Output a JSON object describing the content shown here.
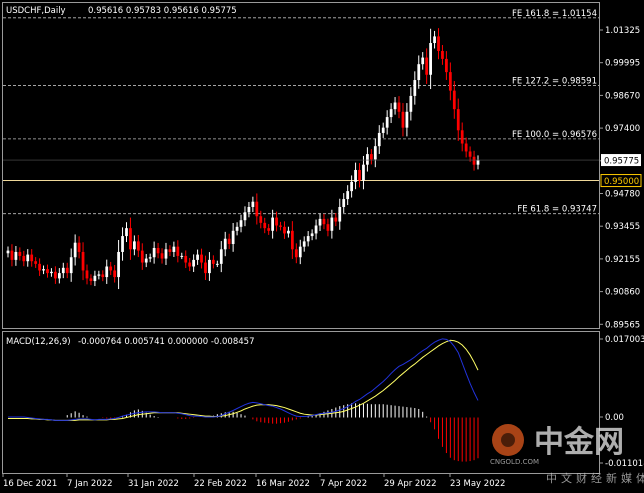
{
  "header": {
    "symbol": "USDCHF,Daily",
    "ohlc": "0.95616 0.95783 0.95616 0.95775"
  },
  "macd_header": {
    "label": "MACD(12,26,9)",
    "values": "-0.000764 0.005741 0.000000 -0.008457"
  },
  "watermark": {
    "cn_big": "中金网",
    "url": "CNGOLD.COM",
    "cn_small": "中文财经新媒体"
  },
  "colors": {
    "background": "#000000",
    "bull": "#ffffff",
    "bear": "#ff0000",
    "macd_main": "#2233dd",
    "macd_signal": "#ffff66",
    "hist_pos": "#ffffff",
    "hist_neg": "#ff0000",
    "level_line": "#f0d99a",
    "current_price_label": "#ffffff",
    "level_label": "#ffcc00"
  },
  "chart_data": [
    {
      "type": "candlestick",
      "title": "USDCHF,Daily",
      "x_tick_labels": [
        "16 Dec 2021",
        "7 Jan 2022",
        "31 Jan 2022",
        "22 Feb 2022",
        "16 Mar 2022",
        "7 Apr 2022",
        "29 Apr 2022",
        "23 May 2022"
      ],
      "y_tick_labels": [
        "1.01325",
        "0.99995",
        "0.98670",
        "0.97400",
        "0.96075",
        "0.94780",
        "0.93455",
        "0.92155",
        "0.90860",
        "0.89565"
      ],
      "ylim": [
        0.895,
        1.016
      ],
      "current_price": 0.95775,
      "current_price_label": "0.95775",
      "level": 0.95,
      "level_label": "0.95000",
      "fibonacci_levels": [
        {
          "label": "FE 161.8 = 1.01154",
          "value": 1.01154
        },
        {
          "label": "FE 127.2 = 0.98591",
          "value": 0.98591
        },
        {
          "label": "FE 100.0 = 0.96576",
          "value": 0.96576
        },
        {
          "label": "FE 61.8 = 0.93747",
          "value": 0.93747
        }
      ],
      "close": [
        0.9235,
        0.92,
        0.923,
        0.9215,
        0.9195,
        0.922,
        0.9195,
        0.9185,
        0.916,
        0.9165,
        0.915,
        0.9155,
        0.913,
        0.915,
        0.917,
        0.915,
        0.921,
        0.9265,
        0.923,
        0.916,
        0.913,
        0.912,
        0.914,
        0.9145,
        0.9135,
        0.9175,
        0.916,
        0.9135,
        0.923,
        0.929,
        0.932,
        0.924,
        0.927,
        0.9235,
        0.919,
        0.9205,
        0.921,
        0.9245,
        0.9225,
        0.9205,
        0.924,
        0.923,
        0.925,
        0.9215,
        0.9215,
        0.919,
        0.9175,
        0.92,
        0.922,
        0.919,
        0.915,
        0.92,
        0.9185,
        0.9185,
        0.924,
        0.928,
        0.926,
        0.931,
        0.9325,
        0.935,
        0.938,
        0.94,
        0.942,
        0.9365,
        0.934,
        0.932,
        0.931,
        0.936,
        0.933,
        0.9325,
        0.93,
        0.931,
        0.924,
        0.921,
        0.925,
        0.927,
        0.929,
        0.93,
        0.933,
        0.9355,
        0.9335,
        0.931,
        0.936,
        0.9345,
        0.94,
        0.943,
        0.946,
        0.9495,
        0.954,
        0.95,
        0.956,
        0.96,
        0.958,
        0.963,
        0.968,
        0.97,
        0.974,
        0.977,
        0.9795,
        0.976,
        0.97,
        0.976,
        0.982,
        0.988,
        0.994,
        0.9965,
        0.99,
        1.002,
        1.0045,
        0.999,
        0.996,
        0.991,
        0.984,
        0.977,
        0.969,
        0.964,
        0.961,
        0.959,
        0.956,
        0.9577
      ]
    },
    {
      "type": "macd",
      "title": "MACD(12,26,9)",
      "y_tick_labels": [
        "0.017003",
        "0.00",
        "-0.011018"
      ],
      "ylim": [
        -0.0115,
        0.0172
      ],
      "macd": [
        0.0001,
        0.0001,
        0.0001,
        0.0001,
        0.0001,
        0.0,
        -0.0001,
        -0.0002,
        -0.0003,
        -0.0004,
        -0.0004,
        -0.0005,
        -0.0006,
        -0.0006,
        -0.0006,
        -0.0006,
        -0.0005,
        -0.0004,
        -0.0003,
        -0.0003,
        -0.0003,
        -0.0004,
        -0.0005,
        -0.0004,
        -0.0004,
        -0.0004,
        -0.0003,
        -0.0002,
        0.0,
        0.0003,
        0.0005,
        0.0007,
        0.0009,
        0.001,
        0.0011,
        0.0012,
        0.0012,
        0.0012,
        0.0011,
        0.001,
        0.001,
        0.001,
        0.001,
        0.0009,
        0.0008,
        0.0006,
        0.0004,
        0.0003,
        0.0003,
        0.0002,
        0.0001,
        0.0001,
        0.0001,
        0.0002,
        0.0004,
        0.0008,
        0.0011,
        0.0015,
        0.0019,
        0.0023,
        0.0027,
        0.003,
        0.0032,
        0.0031,
        0.0029,
        0.0027,
        0.0025,
        0.0024,
        0.0021,
        0.0018,
        0.0014,
        0.001,
        0.0006,
        0.0003,
        0.0002,
        0.0002,
        0.0003,
        0.0004,
        0.0006,
        0.0008,
        0.0009,
        0.001,
        0.0011,
        0.0013,
        0.0016,
        0.0019,
        0.0023,
        0.0028,
        0.0034,
        0.0038,
        0.0044,
        0.005,
        0.0055,
        0.0062,
        0.0069,
        0.0076,
        0.0084,
        0.0093,
        0.0101,
        0.0108,
        0.0112,
        0.0117,
        0.0122,
        0.0128,
        0.0135,
        0.0141,
        0.0146,
        0.0153,
        0.0159,
        0.0163,
        0.0166,
        0.0165,
        0.016,
        0.015,
        0.0137,
        0.0115,
        0.0093,
        0.0072,
        0.0053,
        0.0036
      ],
      "signal": [
        -0.0002,
        -0.0002,
        -0.0002,
        -0.0002,
        -0.0002,
        -0.0002,
        -0.0003,
        -0.0003,
        -0.0004,
        -0.0004,
        -0.0005,
        -0.0005,
        -0.0006,
        -0.0006,
        -0.0006,
        -0.0006,
        -0.0006,
        -0.0006,
        -0.0005,
        -0.0005,
        -0.0005,
        -0.0005,
        -0.0005,
        -0.0005,
        -0.0005,
        -0.0005,
        -0.0004,
        -0.0004,
        -0.0003,
        -0.0002,
        0.0,
        0.0002,
        0.0004,
        0.0006,
        0.0007,
        0.0008,
        0.0009,
        0.001,
        0.001,
        0.001,
        0.001,
        0.001,
        0.001,
        0.001,
        0.0009,
        0.0008,
        0.0007,
        0.0006,
        0.0005,
        0.0004,
        0.0003,
        0.0003,
        0.0002,
        0.0002,
        0.0003,
        0.0004,
        0.0006,
        0.0008,
        0.0011,
        0.0014,
        0.0018,
        0.0021,
        0.0024,
        0.0026,
        0.0027,
        0.0027,
        0.0027,
        0.0026,
        0.0025,
        0.0023,
        0.0021,
        0.0018,
        0.0015,
        0.0012,
        0.0009,
        0.0007,
        0.0006,
        0.0005,
        0.0005,
        0.0006,
        0.0007,
        0.0008,
        0.0009,
        0.001,
        0.0011,
        0.0013,
        0.0016,
        0.0019,
        0.0022,
        0.0026,
        0.003,
        0.0035,
        0.004,
        0.0045,
        0.0051,
        0.0057,
        0.0064,
        0.0071,
        0.0078,
        0.0086,
        0.0093,
        0.01,
        0.0107,
        0.0113,
        0.012,
        0.0127,
        0.0133,
        0.0139,
        0.0145,
        0.0151,
        0.0156,
        0.016,
        0.0163,
        0.0162,
        0.0159,
        0.0153,
        0.0144,
        0.0132,
        0.0117,
        0.01
      ],
      "histogram": [
        0.0,
        0.0,
        0.0,
        0.0,
        0.0,
        0.0,
        0.0,
        0.0,
        0.0,
        0.0,
        0.0,
        0.0,
        0.0,
        0.0,
        0.0,
        0.0005,
        0.0009,
        0.0013,
        0.001,
        0.0005,
        0.0002,
        0.0,
        0.0,
        0.0,
        -0.0001,
        -0.0002,
        -0.0002,
        -0.0001,
        0.0,
        0.0002,
        0.0006,
        0.0011,
        0.0015,
        0.0017,
        0.0014,
        0.001,
        0.0006,
        0.0003,
        0.0001,
        0.0,
        0.0,
        0.0,
        0.0,
        -0.0002,
        -0.0003,
        -0.0003,
        -0.0002,
        -0.0001,
        0.0,
        0.0,
        0.0,
        0.0002,
        0.0004,
        0.0007,
        0.0009,
        0.0011,
        0.0012,
        0.0012,
        0.001,
        0.0007,
        0.0004,
        0.0,
        -0.0004,
        -0.0008,
        -0.001,
        -0.0011,
        -0.0012,
        -0.0013,
        -0.0013,
        -0.0012,
        -0.0011,
        -0.0009,
        -0.0006,
        -0.0004,
        -0.0002,
        0.0,
        0.0002,
        0.0004,
        0.0006,
        0.0009,
        0.0012,
        0.0015,
        0.0018,
        0.0021,
        0.0024,
        0.0026,
        0.0028,
        0.003,
        0.003,
        0.0029,
        0.0029,
        0.0029,
        0.0028,
        0.0028,
        0.0028,
        0.0028,
        0.0027,
        0.0026,
        0.0025,
        0.0024,
        0.0023,
        0.0022,
        0.0021,
        0.002,
        0.0018,
        0.0012,
        0.0002,
        -0.001,
        -0.0025,
        -0.0045,
        -0.0062,
        -0.0075,
        -0.0085,
        -0.009,
        -0.0092,
        -0.0093,
        -0.0093,
        -0.0092,
        -0.009,
        -0.0086
      ]
    }
  ]
}
